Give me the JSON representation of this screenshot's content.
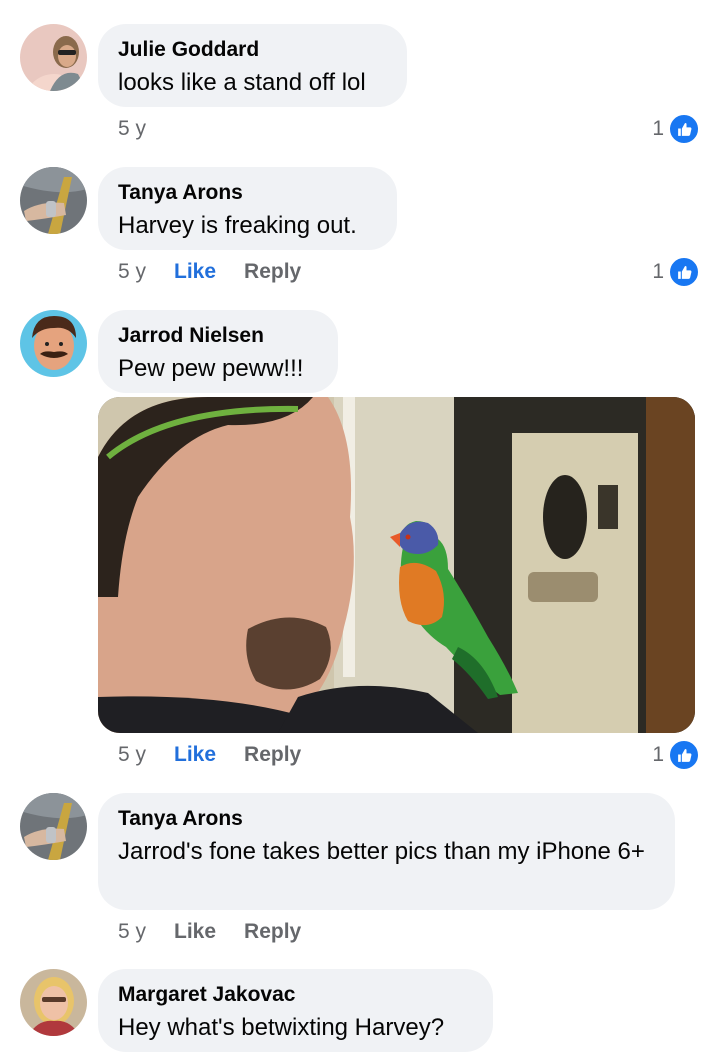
{
  "comments": [
    {
      "author": "Julie Goddard",
      "text": "looks like a stand off lol",
      "time": "5 y",
      "like_label": "",
      "reply_label": "",
      "reactions": "1"
    },
    {
      "author": "Tanya Arons",
      "text": "Harvey is freaking out.",
      "time": "5 y",
      "like_label": "Like",
      "reply_label": "Reply",
      "reactions": "1"
    },
    {
      "author": "Jarrod Nielsen",
      "text": "Pew pew peww!!!",
      "time": "5 y",
      "like_label": "Like",
      "reply_label": "Reply",
      "reactions": "1"
    },
    {
      "author": "Tanya Arons",
      "text": "Jarrod's fone takes better pics than my iPhone 6+",
      "time": "5 y",
      "like_label": "Like",
      "reply_label": "Reply",
      "reactions": ""
    },
    {
      "author": "Margaret Jakovac",
      "text": "Hey what's betwixting Harvey?",
      "time": "",
      "like_label": "",
      "reply_label": "",
      "reactions": ""
    }
  ],
  "icons": {
    "like_reaction": "thumbs-up-icon"
  },
  "colors": {
    "bubble_bg": "#f0f2f5",
    "like_active": "#216fdb",
    "reaction_blue": "#1877f2",
    "meta_gray": "#65676b"
  }
}
